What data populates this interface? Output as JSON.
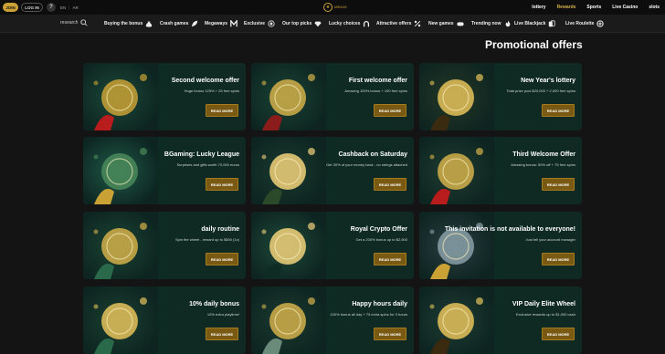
{
  "topbar": {
    "join_label": "JOIN",
    "login_label": "LOG IN",
    "help_label": "?",
    "lang_en": "EN",
    "lang_ar": "AR",
    "logo_text": "MIRAGE",
    "nav": [
      "lottery",
      "Rewards",
      "Sports",
      "Live Casino",
      "slots"
    ]
  },
  "subnav": {
    "search_label": "research",
    "categories": [
      "Buying the bonus",
      "Crash games",
      "Megaways",
      "Exclusive",
      "Our top picks",
      "Lucky choices",
      "Attractive offers",
      "New games",
      "Trending now",
      "Live Blackjack",
      "Live Roulette"
    ]
  },
  "page_title": "Promotional offers",
  "read_more_label": "READ MORE",
  "offers": [
    {
      "title": "Second welcome offer",
      "desc": "Huge bonus 125% + 25 free spins"
    },
    {
      "title": "First welcome offer",
      "desc": "Amazing 100% bonus + 100 free spins"
    },
    {
      "title": "New Year's lottery",
      "desc": "Total prize pool $20,000 + 2,000 free spins"
    },
    {
      "title": "BGaming: Lucky League",
      "desc": "Surprises and gifts worth 70,000 euros"
    },
    {
      "title": "Cashback on Saturday",
      "desc": "Get 30% of your money back - no strings attached"
    },
    {
      "title": "Third Welcome Offer",
      "desc": "Amazing bonus: 50% off + 75 free spins"
    },
    {
      "title": "daily routine",
      "desc": "Spin the wheel - reward up to $500 (1x)"
    },
    {
      "title": "Royal Crypto Offer",
      "desc": "Get a 200% bonus up to $2,500"
    },
    {
      "title": "This invitation is not available to everyone!",
      "desc": "Just tell your account manager"
    },
    {
      "title": "10% daily bonus",
      "desc": "10% extra playtime!"
    },
    {
      "title": "Happy hours daily",
      "desc": "100% bonus all day + 75 extra spins for 3 hours"
    },
    {
      "title": "VIP Daily Elite Wheel",
      "desc": "Exclusive rewards up to $1,000 cash"
    }
  ],
  "colors": {
    "accent": "#c9a135",
    "card_bg": "#0f2c24",
    "button": "#7a5a13",
    "page_bg": "#141414"
  }
}
